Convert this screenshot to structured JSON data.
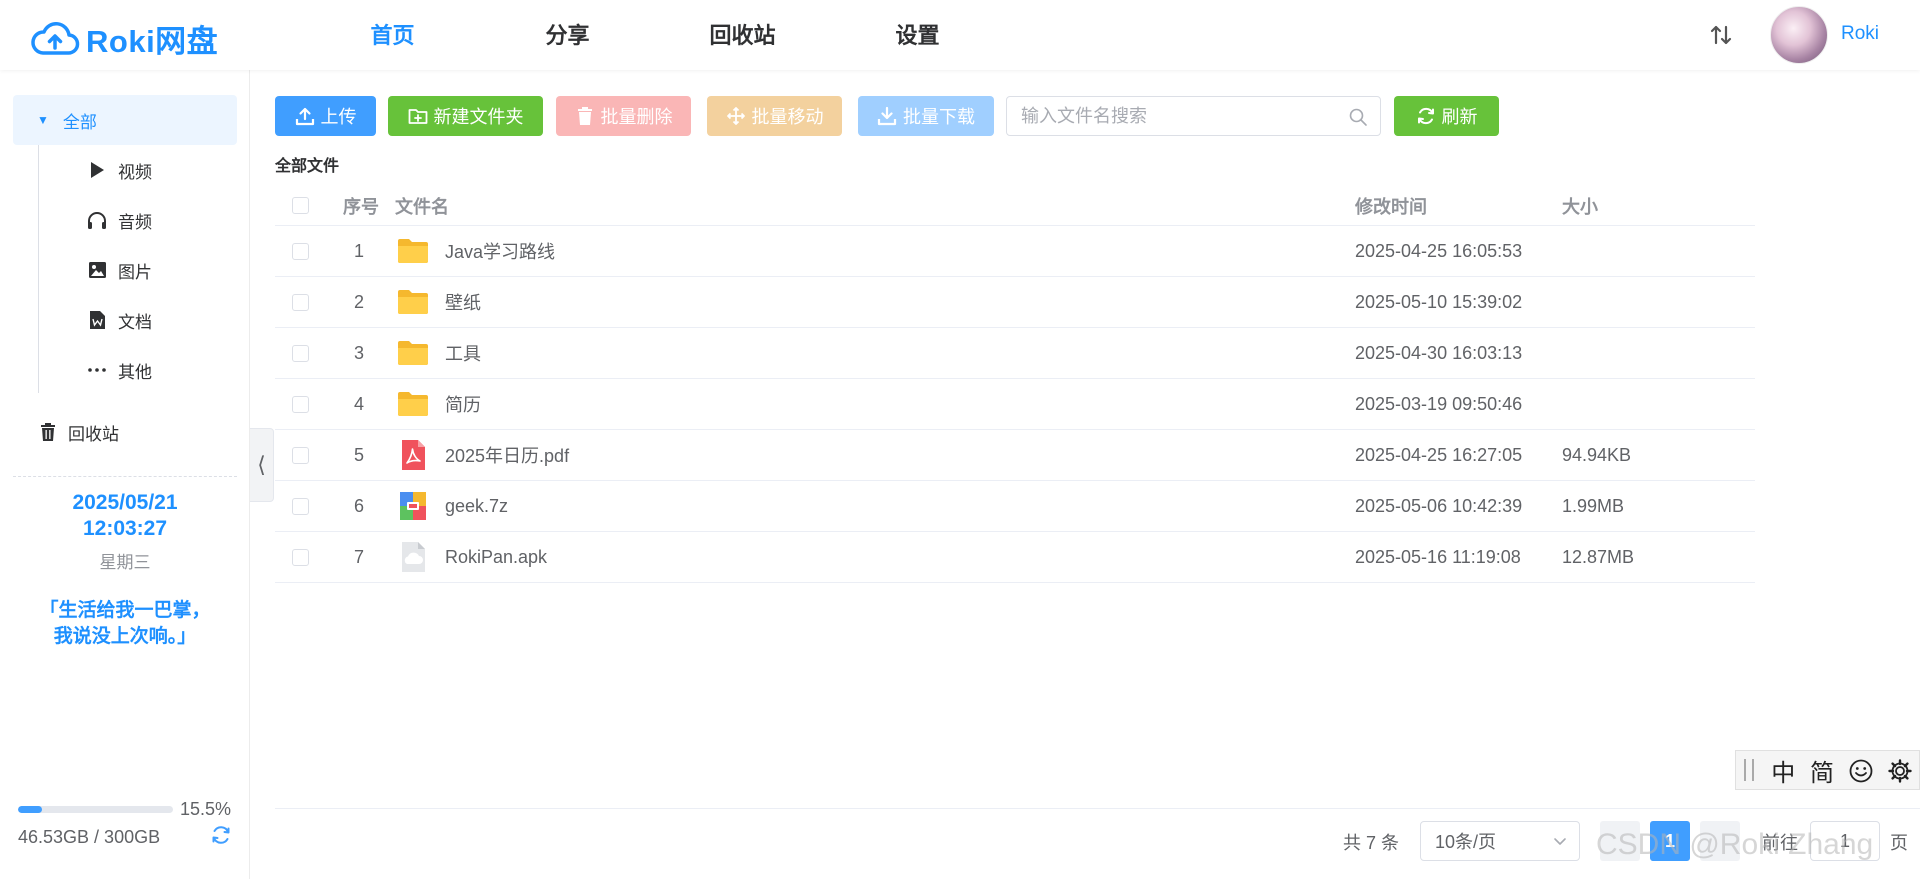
{
  "header": {
    "logo_text": "Roki网盘",
    "nav": [
      "首页",
      "分享",
      "回收站",
      "设置"
    ],
    "active_nav_index": 0,
    "username": "Roki",
    "accent_color": "#1e90ff"
  },
  "sidebar": {
    "all_label": "全部",
    "categories": [
      {
        "label": "视频",
        "icon": "play-icon"
      },
      {
        "label": "音频",
        "icon": "headphones-icon"
      },
      {
        "label": "图片",
        "icon": "image-icon"
      },
      {
        "label": "文档",
        "icon": "document-icon"
      },
      {
        "label": "其他",
        "icon": "more-icon"
      }
    ],
    "recycle_label": "回收站",
    "date": "2025/05/21",
    "time": "12:03:27",
    "weekday": "星期三",
    "quote_line1": "「生活给我一巴掌，",
    "quote_line2": "我说没上次响。」",
    "storage": {
      "percent_label": "15.5%",
      "percent": 15.5,
      "used_label": "46.53GB / 300GB"
    }
  },
  "toolbar": {
    "upload": "上传",
    "new_folder": "新建文件夹",
    "batch_delete": "批量删除",
    "batch_move": "批量移动",
    "batch_download": "批量下载",
    "search_placeholder": "输入文件名搜索",
    "refresh": "刷新"
  },
  "breadcrumb": "全部文件",
  "table": {
    "columns": {
      "index": "序号",
      "name": "文件名",
      "modified": "修改时间",
      "size": "大小"
    },
    "rows": [
      {
        "index": "1",
        "name": "Java学习路线",
        "type": "folder",
        "modified": "2025-04-25 16:05:53",
        "size": ""
      },
      {
        "index": "2",
        "name": "壁纸",
        "type": "folder",
        "modified": "2025-05-10 15:39:02",
        "size": ""
      },
      {
        "index": "3",
        "name": "工具",
        "type": "folder",
        "modified": "2025-04-30 16:03:13",
        "size": ""
      },
      {
        "index": "4",
        "name": "简历",
        "type": "folder",
        "modified": "2025-03-19 09:50:46",
        "size": ""
      },
      {
        "index": "5",
        "name": "2025年日历.pdf",
        "type": "pdf",
        "modified": "2025-04-25 16:27:05",
        "size": "94.94KB"
      },
      {
        "index": "6",
        "name": "geek.7z",
        "type": "archive",
        "modified": "2025-05-06 10:42:39",
        "size": "1.99MB"
      },
      {
        "index": "7",
        "name": "RokiPan.apk",
        "type": "apk",
        "modified": "2025-05-16 11:19:08",
        "size": "12.87MB"
      }
    ]
  },
  "pagination": {
    "total": "共 7 条",
    "page_size": "10条/页",
    "current_page": "1",
    "goto_label": "前往",
    "goto_value": "1",
    "goto_suffix": "页"
  },
  "ime": {
    "keys": [
      "中",
      "简"
    ]
  },
  "watermark": "CSDN @Roki Zhang"
}
